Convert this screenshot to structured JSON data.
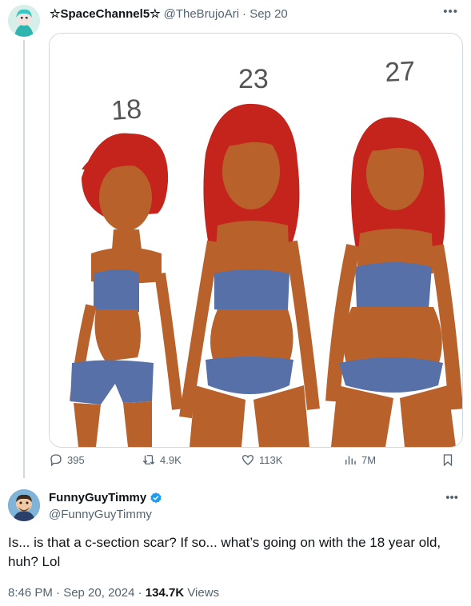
{
  "original_tweet": {
    "display_name": "☆SpaceChannel5☆",
    "handle": "@TheBrujoAri",
    "date": "· Sep 20",
    "more_icon": "ellipsis-icon",
    "media_labels": [
      "18",
      "23",
      "27"
    ],
    "stats": {
      "replies": "395",
      "reposts": "4.9K",
      "likes": "113K",
      "views": "7M"
    }
  },
  "reply_tweet": {
    "display_name": "FunnyGuyTimmy",
    "handle": "@FunnyGuyTimmy",
    "verified": true,
    "text": "Is... is that a c-section scar? If so... what’s going on with the 18 year old, huh? Lol",
    "timestamp": "8:46 PM · Sep 20, 2024 · ",
    "views_count": "134.7K",
    "views_label": " Views"
  },
  "colors": {
    "skin": "#b8612b",
    "hair": "#c4241c",
    "clothes": "#5870a8",
    "accent": "#1d9bf0"
  }
}
